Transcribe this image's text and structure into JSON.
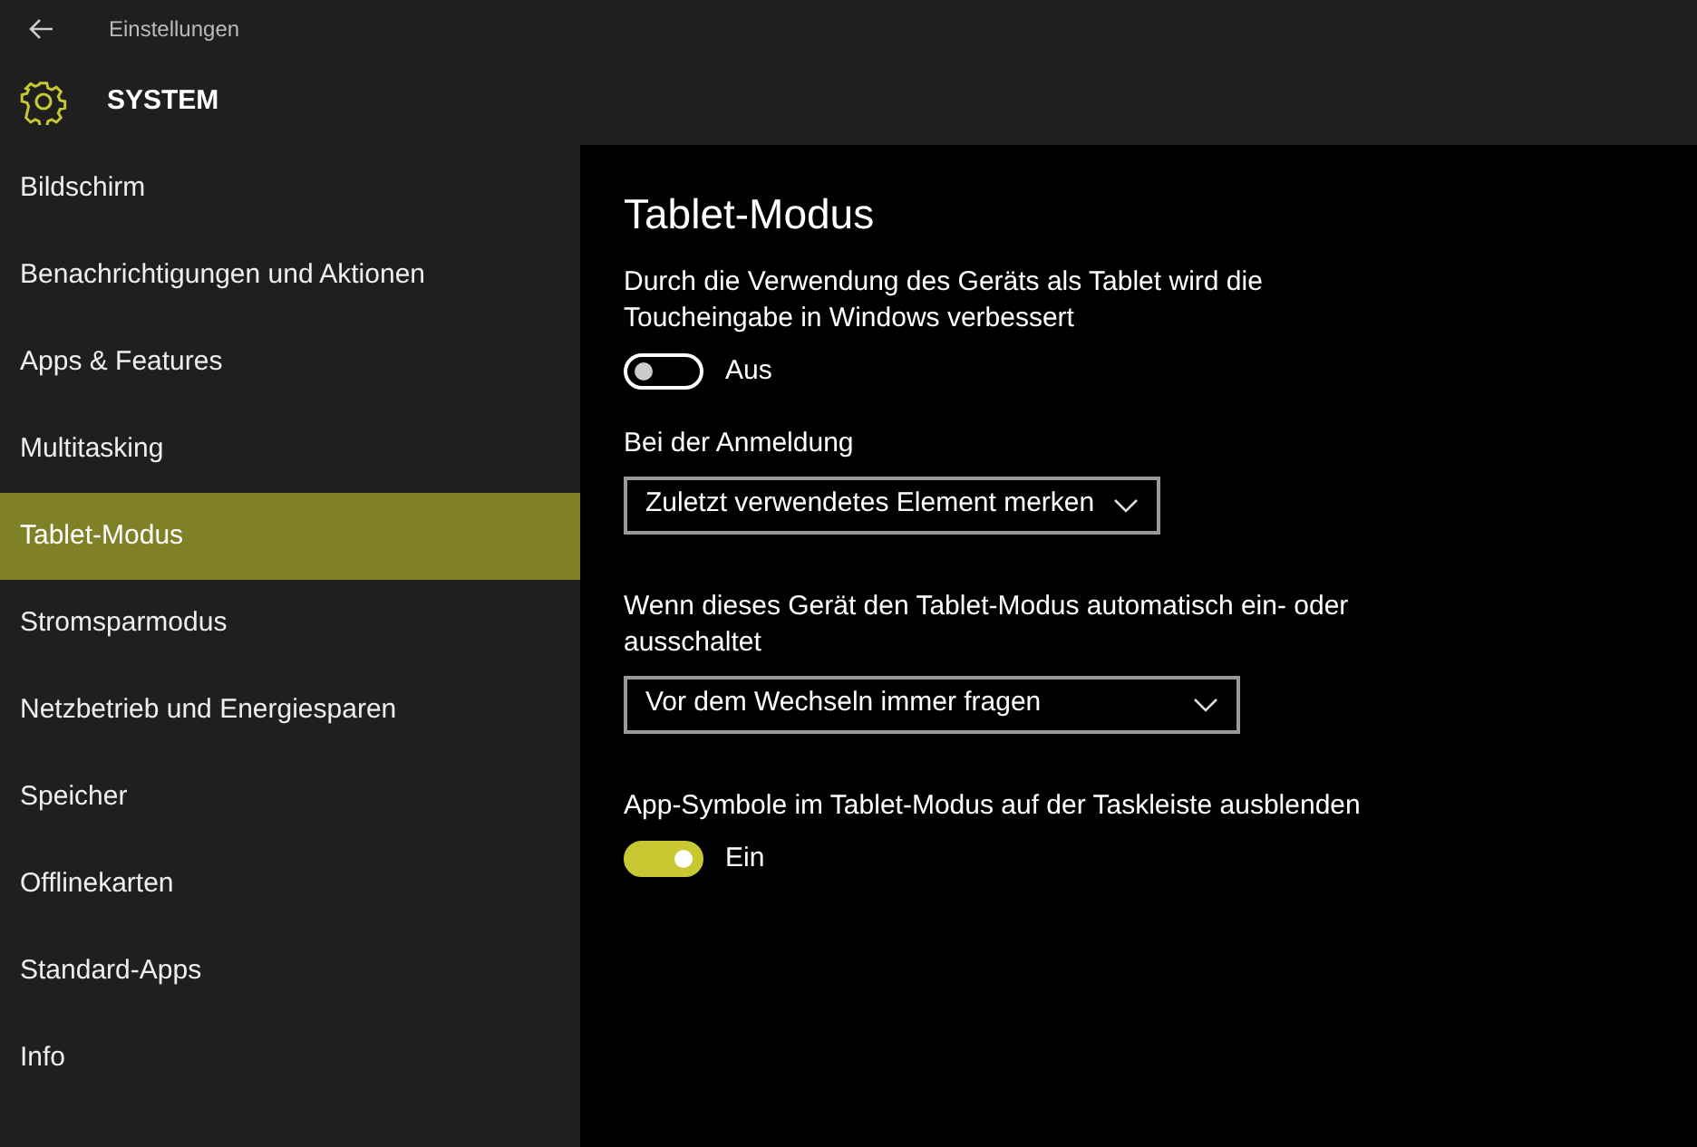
{
  "window": {
    "title": "Einstellungen"
  },
  "header": {
    "title": "SYSTEM"
  },
  "sidebar": {
    "items": [
      {
        "label": "Bildschirm",
        "selected": false
      },
      {
        "label": "Benachrichtigungen und Aktionen",
        "selected": false
      },
      {
        "label": "Apps & Features",
        "selected": false
      },
      {
        "label": "Multitasking",
        "selected": false
      },
      {
        "label": "Tablet-Modus",
        "selected": true
      },
      {
        "label": "Stromsparmodus",
        "selected": false
      },
      {
        "label": "Netzbetrieb und Energiesparen",
        "selected": false
      },
      {
        "label": "Speicher",
        "selected": false
      },
      {
        "label": "Offlinekarten",
        "selected": false
      },
      {
        "label": "Standard-Apps",
        "selected": false
      },
      {
        "label": "Info",
        "selected": false
      }
    ]
  },
  "content": {
    "heading": "Tablet-Modus",
    "settings": [
      {
        "kind": "toggle",
        "label": "Durch die Verwendung des Geräts als Tablet wird die Toucheingabe in Windows verbessert",
        "on": false,
        "state_text": "Aus"
      },
      {
        "kind": "dropdown",
        "label": "Bei der Anmeldung",
        "value": "Zuletzt verwendetes Element merken"
      },
      {
        "kind": "dropdown",
        "label": "Wenn dieses Gerät den Tablet-Modus automatisch ein- oder ausschaltet",
        "value": "Vor dem Wechseln immer fragen"
      },
      {
        "kind": "toggle",
        "label": "App-Symbole im Tablet-Modus auf der Taskleiste ausblenden",
        "on": true,
        "state_text": "Ein"
      }
    ]
  }
}
